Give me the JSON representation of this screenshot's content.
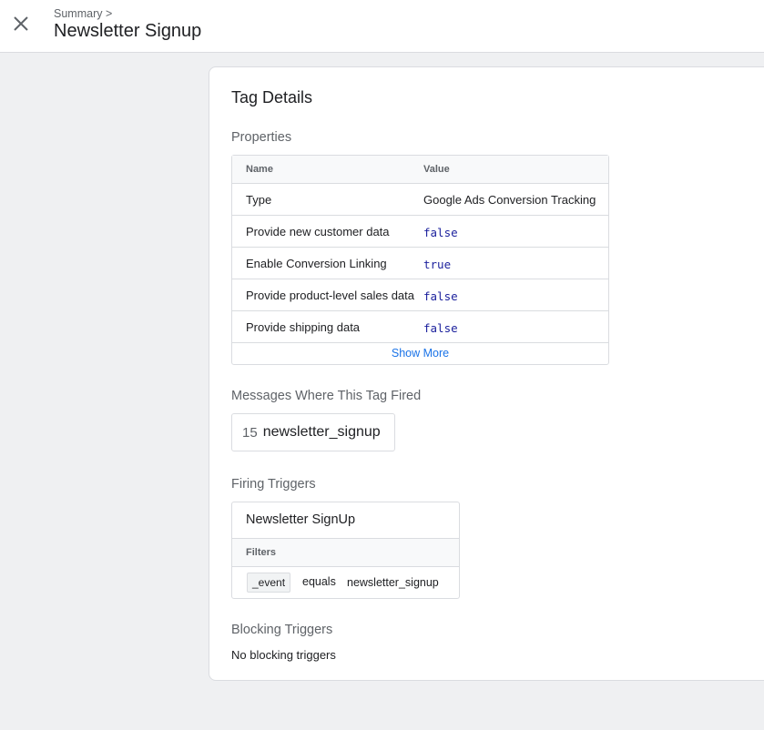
{
  "header": {
    "breadcrumb": "Summary >",
    "title": "Newsletter Signup"
  },
  "card": {
    "title": "Tag Details",
    "properties": {
      "label": "Properties",
      "col_name": "Name",
      "col_value": "Value",
      "rows": [
        {
          "name": "Type",
          "value": "Google Ads Conversion Tracking"
        },
        {
          "name": "Provide new customer data",
          "value": "false"
        },
        {
          "name": "Enable Conversion Linking",
          "value": "true"
        },
        {
          "name": "Provide product-level sales data",
          "value": "false"
        },
        {
          "name": "Provide shipping data",
          "value": "false"
        }
      ],
      "show_more": "Show More"
    },
    "messages": {
      "label": "Messages Where This Tag Fired",
      "number": "15",
      "name": "newsletter_signup"
    },
    "firing": {
      "label": "Firing Triggers",
      "trigger_name": "Newsletter SignUp",
      "filters_label": "Filters",
      "filter": {
        "variable": "_event",
        "operator": "equals",
        "value": "newsletter_signup"
      }
    },
    "blocking": {
      "label": "Blocking Triggers",
      "empty_text": "No blocking triggers"
    }
  }
}
